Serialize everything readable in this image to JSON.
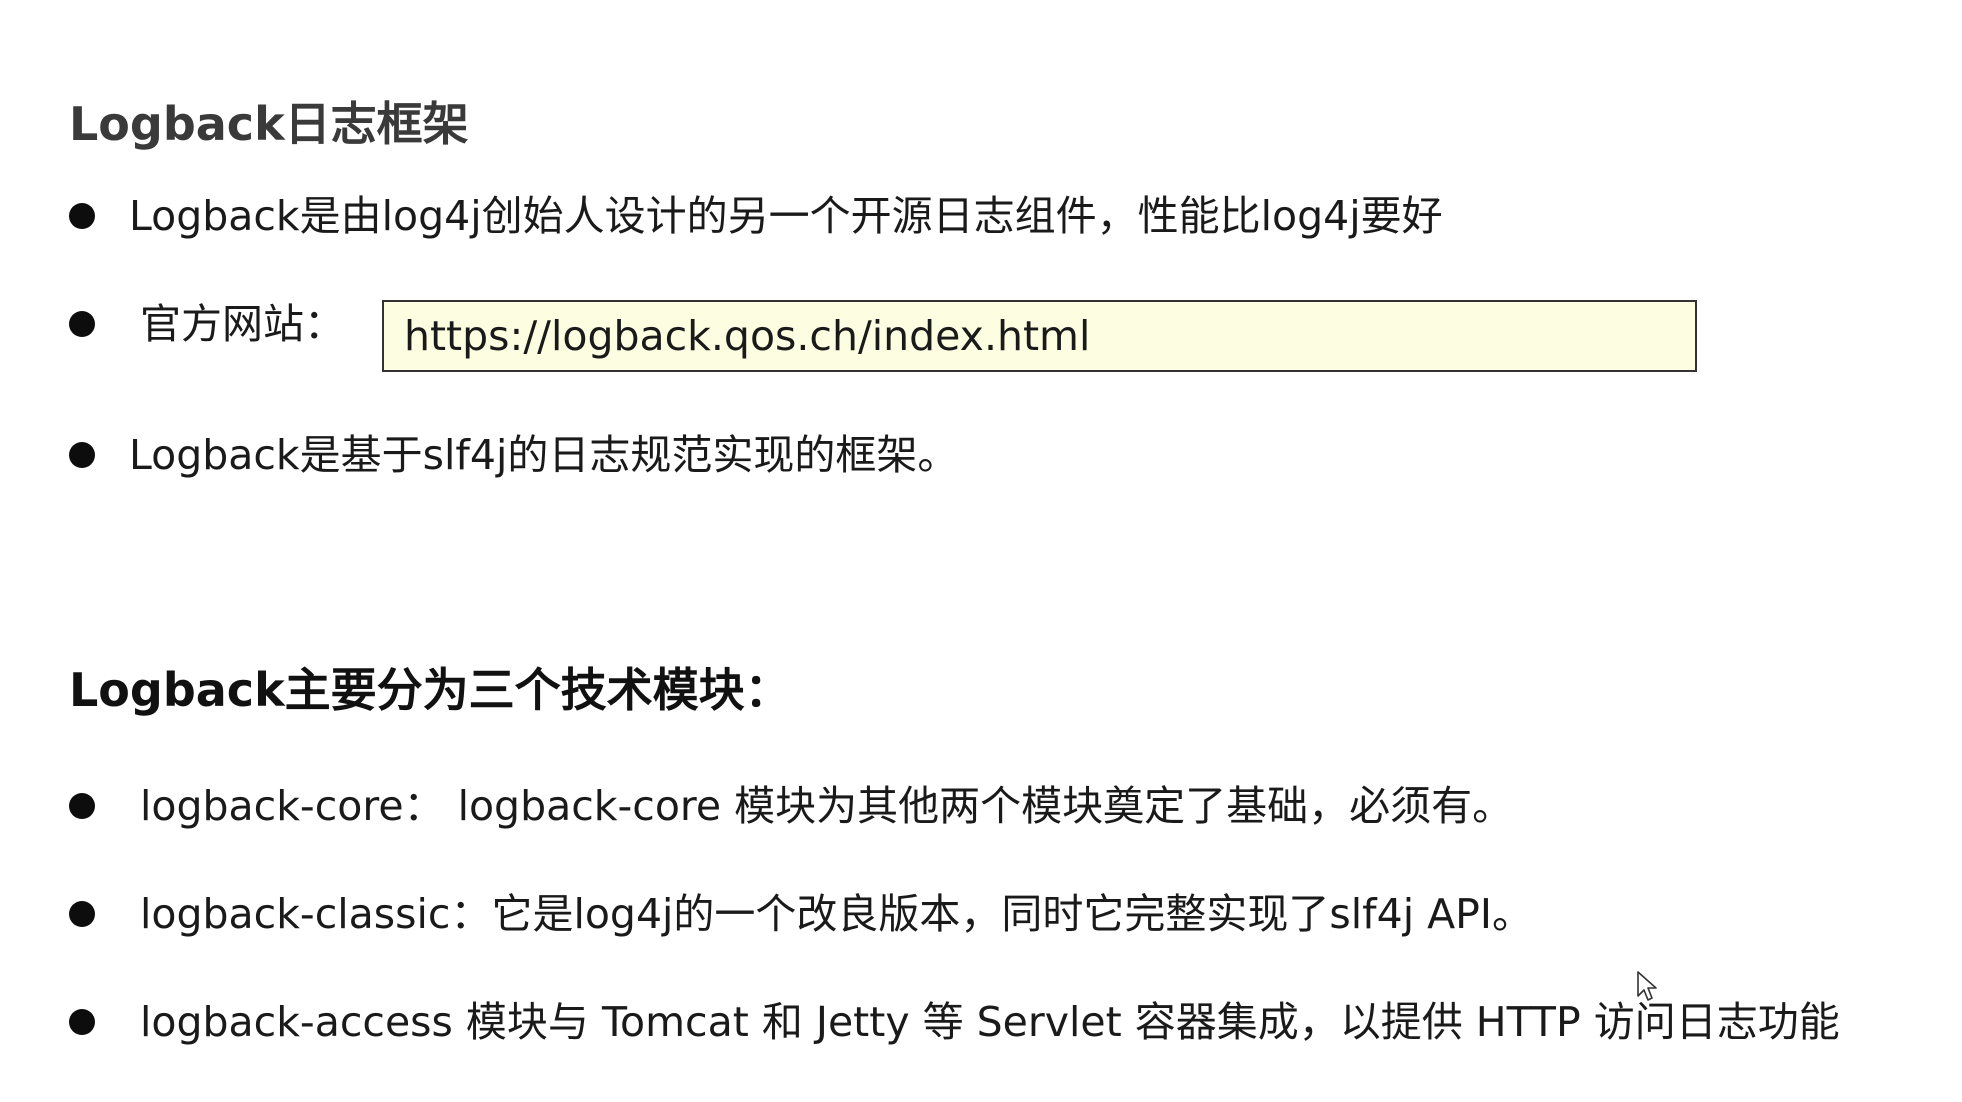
{
  "section1": {
    "title": "Logback日志框架",
    "bullets": [
      "Logback是由log4j创始人设计的另一个开源日志组件，性能比log4j要好",
      "官方网站：",
      "Logback是基于slf4j的日志规范实现的框架。"
    ],
    "website_url": "https://logback.qos.ch/index.html"
  },
  "section2": {
    "title": "Logback主要分为三个技术模块：",
    "bullets": [
      "logback-core： logback-core 模块为其他两个模块奠定了基础，必须有。",
      "logback-classic：它是log4j的一个改良版本，同时它完整实现了slf4j API。",
      "logback-access 模块与 Tomcat 和 Jetty 等 Servlet 容器集成，以提供 HTTP 访问日志功能"
    ]
  },
  "colors": {
    "url_box_background": "#fdfde2",
    "url_box_border": "#333333",
    "text": "#1a1a1a"
  },
  "icons": {
    "bullet": "filled-circle",
    "cursor": "mouse-pointer-icon"
  }
}
